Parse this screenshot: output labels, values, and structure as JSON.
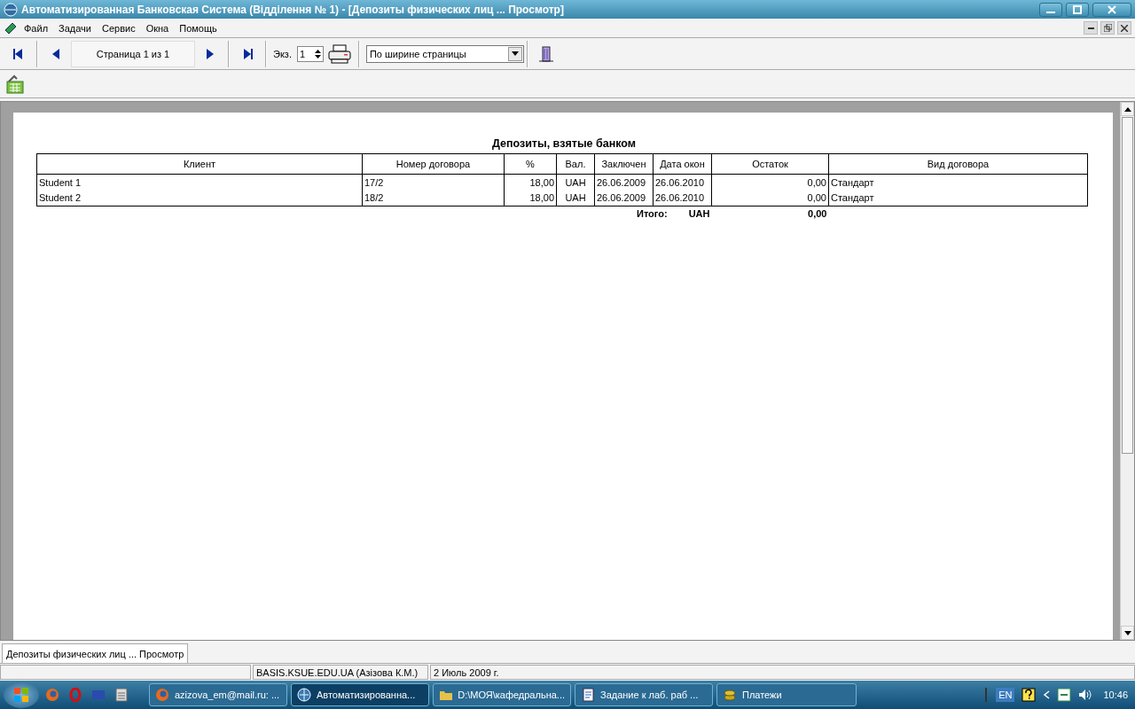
{
  "window": {
    "title": "Автоматизированная Банковская Система (Відділення № 1) - [Депозиты физических лиц ... Просмотр]"
  },
  "menu": [
    "Файл",
    "Задачи",
    "Сервис",
    "Окна",
    "Помощь"
  ],
  "toolbar": {
    "page_label": "Страница 1 из 1",
    "copies_label": "Экз.",
    "copies_value": "1",
    "zoom_value": "По ширине страницы"
  },
  "report": {
    "title": "Депозиты, взятые банком",
    "columns": [
      "Клиент",
      "Номер договора",
      "%",
      "Вал.",
      "Заключен",
      "Дата окон",
      "Остаток",
      "Вид договора"
    ],
    "rows": [
      [
        "Student 1",
        "17/2",
        "18,00",
        "UAH",
        "26.06.2009",
        "26.06.2010",
        "0,00",
        "Стандарт"
      ],
      [
        "Student 2",
        "18/2",
        "18,00",
        "UAH",
        "26.06.2009",
        "26.06.2010",
        "0,00",
        "Стандарт"
      ]
    ],
    "total": {
      "label": "Итого:",
      "currency": "UAH",
      "amount": "0,00"
    }
  },
  "document_tabs": [
    {
      "label": "Депозиты физических лиц ... Просмотр",
      "selected": true
    }
  ],
  "status_bar": [
    "BASIS.KSUE.EDU.UA (Азізова К.М.)",
    "2 Июль 2009 г."
  ],
  "taskbar": {
    "buttons": [
      {
        "label": "azizova_em@mail.ru: ...",
        "kind": "browser",
        "selected": false
      },
      {
        "label": "Автоматизированна...",
        "kind": "globe",
        "selected": true
      },
      {
        "label": "D:\\МОЯ\\кафедральна...",
        "kind": "folder",
        "selected": false
      },
      {
        "label": "Задание к лаб. раб ...",
        "kind": "document",
        "selected": false
      },
      {
        "label": "Платежи",
        "kind": "coins",
        "selected": false
      }
    ],
    "language": "EN",
    "clock": "10:46"
  }
}
